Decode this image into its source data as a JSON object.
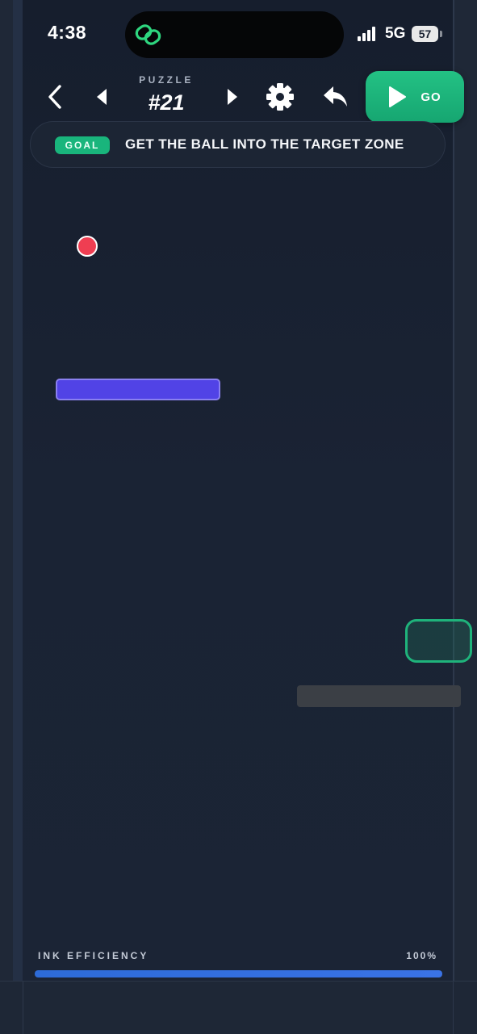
{
  "status_bar": {
    "time": "4:38",
    "network": "5G",
    "battery": "57"
  },
  "toolbar": {
    "puzzle_caption": "PUZZLE",
    "puzzle_number": "#21",
    "go_label": "GO"
  },
  "goal": {
    "badge": "GOAL",
    "text": "GET THE BALL INTO THE TARGET ZONE"
  },
  "ink": {
    "label": "INK EFFICIENCY",
    "value_text": "100%",
    "fraction": 1.0
  },
  "colors": {
    "go_button": "#1db47a",
    "goal_badge": "#19b57c",
    "ball": "#ef3e52",
    "paddle": "#5143e6",
    "target_outline": "#1fb37b",
    "platform": "#3b3f45",
    "ink_bar": "#3a73e6"
  },
  "icons": {
    "back": "chevron-left-icon",
    "prev": "triangle-left-icon",
    "next": "triangle-right-icon",
    "settings": "gear-icon",
    "undo": "undo-arrow-icon",
    "go": "play-icon",
    "island": "link-rings-icon"
  }
}
